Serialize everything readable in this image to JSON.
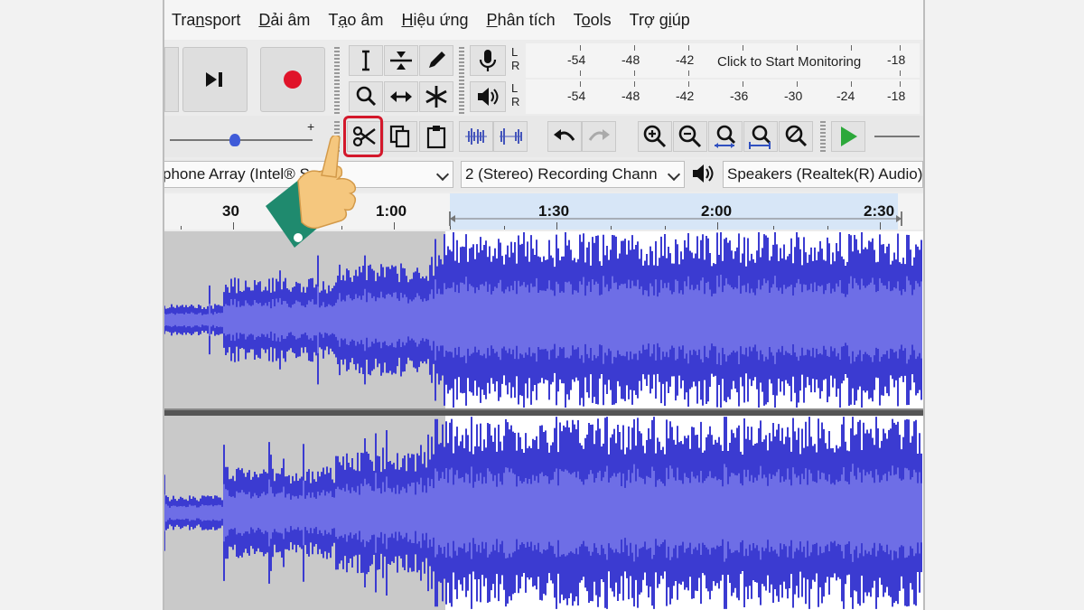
{
  "menu": {
    "items": [
      {
        "pre": "Tra",
        "u": "n",
        "post": "sport"
      },
      {
        "pre": "",
        "u": "D",
        "post": "ải âm"
      },
      {
        "pre": "T",
        "u": "ạ",
        "post": "o âm"
      },
      {
        "pre": "",
        "u": "H",
        "post": "iệu ứng"
      },
      {
        "pre": "",
        "u": "P",
        "post": "hân tích"
      },
      {
        "pre": "T",
        "u": "o",
        "post": "ols"
      },
      {
        "pre": "Trợ g",
        "u": "i",
        "post": "úp"
      }
    ]
  },
  "transport": {
    "skip_end_icon": "skip-to-end-icon",
    "record_icon": "record-icon",
    "record_color": "#e0142a"
  },
  "tools": [
    "selection-tool-icon",
    "envelope-tool-icon",
    "draw-tool-icon",
    "zoom-tool-icon",
    "time-shift-tool-icon",
    "multi-tool-icon"
  ],
  "meters": {
    "record": {
      "channels": [
        "L",
        "R"
      ],
      "ticks": [
        "-54",
        "-48",
        "-42",
        "-18"
      ],
      "prompt": "Click to Start Monitoring"
    },
    "playback": {
      "channels": [
        "L",
        "R"
      ],
      "ticks": [
        "-54",
        "-48",
        "-42",
        "-36",
        "-30",
        "-24",
        "-18"
      ]
    }
  },
  "edit_toolbar": {
    "slider_plus": "+",
    "icons": [
      "cut-icon",
      "copy-icon",
      "paste-icon",
      "trim-icon",
      "silence-icon",
      "undo-icon",
      "redo-icon",
      "zoom-in-icon",
      "zoom-out-icon",
      "fit-selection-icon",
      "fit-project-icon",
      "zoom-toggle-icon",
      "play-at-speed-icon"
    ],
    "highlighted": "cut-icon",
    "highlight_color": "#d3182b"
  },
  "devices": {
    "recording_device": "phone Array (Intel® Smart",
    "channels": "2 (Stereo) Recording Chann",
    "playback_device": "Speakers (Realtek(R) Audio)"
  },
  "timeline": {
    "labels": [
      "30",
      "1:00",
      "1:30",
      "2:00",
      "2:30"
    ]
  },
  "waveform": {
    "color": "#3b3bd1",
    "rms_color": "#6e6ee6",
    "background": "#c9c9c9",
    "selected_background": "#ffffff",
    "selection_start_fraction": 0.37
  }
}
